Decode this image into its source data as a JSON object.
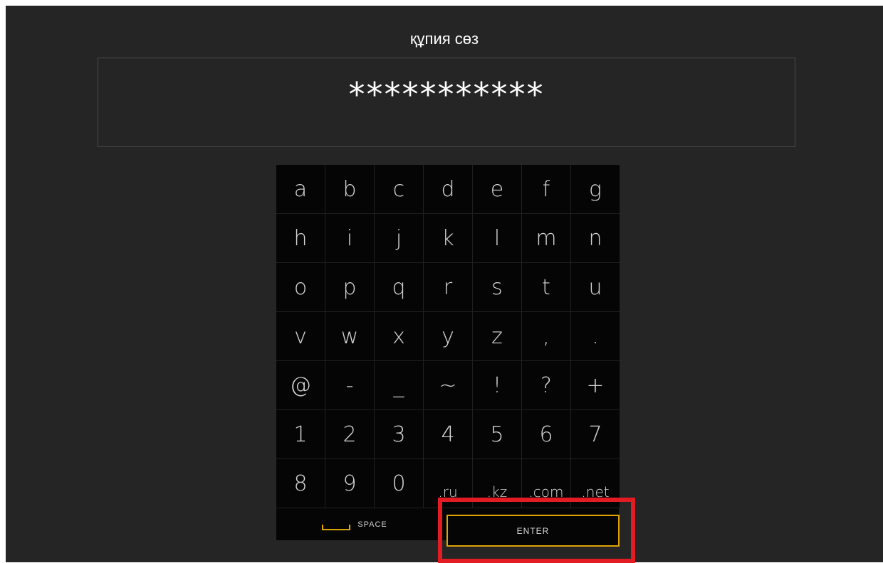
{
  "header": {
    "title": "құпия сөз"
  },
  "password": {
    "value": "***********"
  },
  "keyboard": {
    "rows": [
      [
        "a",
        "b",
        "c",
        "d",
        "e",
        "f",
        "g"
      ],
      [
        "h",
        "i",
        "j",
        "k",
        "l",
        "m",
        "n"
      ],
      [
        "o",
        "p",
        "q",
        "r",
        "s",
        "t",
        "u"
      ],
      [
        "v",
        "w",
        "x",
        "y",
        "z",
        ",",
        "."
      ],
      [
        "@",
        "-",
        "_",
        "~",
        "!",
        "?",
        "+"
      ],
      [
        "1",
        "2",
        "3",
        "4",
        "5",
        "6",
        "7"
      ],
      [
        "8",
        "9",
        "0",
        ".ru",
        ".kz",
        ".com",
        ".net"
      ]
    ],
    "space_label": "SPACE",
    "enter_label": "ENTER"
  },
  "colors": {
    "background": "#252525",
    "keyboard": "#050505",
    "accent": "#e0a400",
    "highlight": "#e21c22",
    "text": "#d6d6d6"
  }
}
